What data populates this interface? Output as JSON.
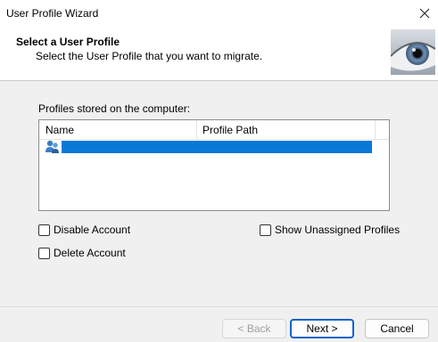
{
  "window": {
    "title": "User Profile Wizard"
  },
  "header": {
    "title": "Select a User Profile",
    "subtitle": "Select the User Profile that you want to migrate."
  },
  "profiles": {
    "label": "Profiles stored on the computer:",
    "columns": [
      "Name",
      "Profile Path"
    ],
    "rows": [
      {
        "selected": true
      }
    ]
  },
  "options": {
    "disable_account": "Disable Account",
    "delete_account": "Delete Account",
    "show_unassigned": "Show Unassigned Profiles"
  },
  "buttons": {
    "back": "< Back",
    "next": "Next >",
    "cancel": "Cancel"
  },
  "colors": {
    "selection": "#0a78d7",
    "default_button_border": "#0a64c9"
  }
}
